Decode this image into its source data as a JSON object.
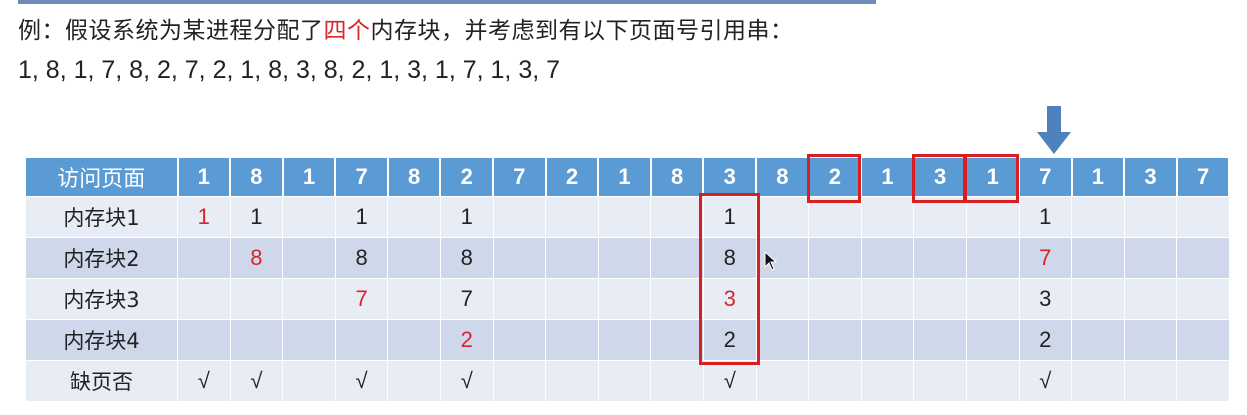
{
  "prompt": {
    "part1": "例：假设系统为某进程分配了",
    "highlight": "四个",
    "part2": "内存块，并考虑到有以下页面号引用串："
  },
  "reference_string": "1, 8, 1, 7, 8, 2, 7, 2, 1, 8, 3, 8, 2, 1, 3, 1, 7, 1, 3, 7",
  "colors": {
    "header_blue": "#5b9bd5",
    "row_light": "#e8ecf5",
    "row_mid": "#cfd8eb",
    "new_page_red": "#d9252a",
    "highlight_box": "#d81e1e",
    "arrow": "#4f81bd"
  },
  "table": {
    "header_label": "访问页面",
    "pages": [
      "1",
      "8",
      "1",
      "7",
      "8",
      "2",
      "7",
      "2",
      "1",
      "8",
      "3",
      "8",
      "2",
      "1",
      "3",
      "1",
      "7",
      "1",
      "3",
      "7"
    ],
    "rows": [
      {
        "label": "内存块1",
        "cells": [
          {
            "v": "1",
            "new": true
          },
          {
            "v": "1"
          },
          {
            "v": ""
          },
          {
            "v": "1"
          },
          {
            "v": ""
          },
          {
            "v": "1"
          },
          {
            "v": ""
          },
          {
            "v": ""
          },
          {
            "v": ""
          },
          {
            "v": ""
          },
          {
            "v": "1"
          },
          {
            "v": ""
          },
          {
            "v": ""
          },
          {
            "v": ""
          },
          {
            "v": ""
          },
          {
            "v": ""
          },
          {
            "v": "1"
          },
          {
            "v": ""
          },
          {
            "v": ""
          },
          {
            "v": ""
          }
        ]
      },
      {
        "label": "内存块2",
        "cells": [
          {
            "v": ""
          },
          {
            "v": "8",
            "new": true
          },
          {
            "v": ""
          },
          {
            "v": "8"
          },
          {
            "v": ""
          },
          {
            "v": "8"
          },
          {
            "v": ""
          },
          {
            "v": ""
          },
          {
            "v": ""
          },
          {
            "v": ""
          },
          {
            "v": "8"
          },
          {
            "v": ""
          },
          {
            "v": ""
          },
          {
            "v": ""
          },
          {
            "v": ""
          },
          {
            "v": ""
          },
          {
            "v": "7",
            "new": true
          },
          {
            "v": ""
          },
          {
            "v": ""
          },
          {
            "v": ""
          }
        ]
      },
      {
        "label": "内存块3",
        "cells": [
          {
            "v": ""
          },
          {
            "v": ""
          },
          {
            "v": ""
          },
          {
            "v": "7",
            "new": true
          },
          {
            "v": ""
          },
          {
            "v": "7"
          },
          {
            "v": ""
          },
          {
            "v": ""
          },
          {
            "v": ""
          },
          {
            "v": ""
          },
          {
            "v": "3",
            "new": true
          },
          {
            "v": ""
          },
          {
            "v": ""
          },
          {
            "v": ""
          },
          {
            "v": ""
          },
          {
            "v": ""
          },
          {
            "v": "3"
          },
          {
            "v": ""
          },
          {
            "v": ""
          },
          {
            "v": ""
          }
        ]
      },
      {
        "label": "内存块4",
        "cells": [
          {
            "v": ""
          },
          {
            "v": ""
          },
          {
            "v": ""
          },
          {
            "v": ""
          },
          {
            "v": ""
          },
          {
            "v": "2",
            "new": true
          },
          {
            "v": ""
          },
          {
            "v": ""
          },
          {
            "v": ""
          },
          {
            "v": ""
          },
          {
            "v": "2"
          },
          {
            "v": ""
          },
          {
            "v": ""
          },
          {
            "v": ""
          },
          {
            "v": ""
          },
          {
            "v": ""
          },
          {
            "v": "2"
          },
          {
            "v": ""
          },
          {
            "v": ""
          },
          {
            "v": ""
          }
        ]
      },
      {
        "label": "缺页否",
        "cells": [
          {
            "v": "√"
          },
          {
            "v": "√"
          },
          {
            "v": ""
          },
          {
            "v": "√"
          },
          {
            "v": ""
          },
          {
            "v": "√"
          },
          {
            "v": ""
          },
          {
            "v": ""
          },
          {
            "v": ""
          },
          {
            "v": ""
          },
          {
            "v": "√"
          },
          {
            "v": ""
          },
          {
            "v": ""
          },
          {
            "v": ""
          },
          {
            "v": ""
          },
          {
            "v": ""
          },
          {
            "v": "√"
          },
          {
            "v": ""
          },
          {
            "v": ""
          },
          {
            "v": ""
          }
        ]
      }
    ]
  },
  "annotations": {
    "arrow_icon": "down-arrow-icon",
    "arrow_points_to_column": 16,
    "boxed_header_columns": [
      12,
      14,
      15
    ],
    "boxed_memory_column": 10
  }
}
